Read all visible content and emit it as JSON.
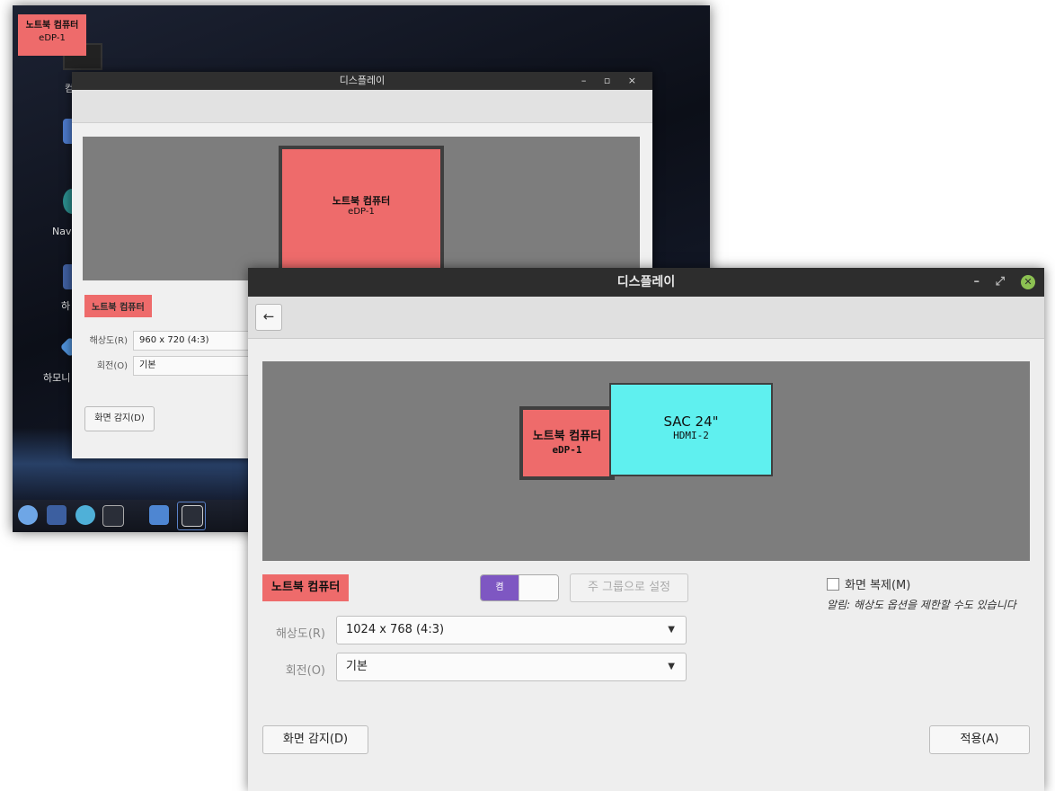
{
  "background_window": {
    "osd_label": {
      "name": "노트북 컴퓨터",
      "connector": "eDP-1"
    },
    "title": "디스플레이",
    "controls": "– ▫ ×",
    "monitor": {
      "name": "노트북 컴퓨터",
      "connector": "eDP-1"
    },
    "monitor_tag": "노트북 컴퓨터",
    "resolution_label": "해상도(R)",
    "resolution_value": "960 x 720 (4:3)",
    "rotation_label": "회전(O)",
    "rotation_value": "기본",
    "detect_button": "화면 감지(D)",
    "desktop_icons": [
      "컴",
      "Nave",
      "하",
      "하모니"
    ]
  },
  "window": {
    "title": "디스플레이",
    "minimize": "–",
    "maximize": "⤢",
    "close": "✕"
  },
  "toolbar": {
    "back_icon": "←"
  },
  "monitors": [
    {
      "name": "노트북 컴퓨터",
      "connector": "eDP-1",
      "color": "#ee6b6b"
    },
    {
      "name": "SAC 24\"",
      "connector": "HDMI-2",
      "color": "#5ff0ef"
    }
  ],
  "settings": {
    "selected_monitor": "노트북 컴퓨터",
    "toggle_on_label": "켬",
    "set_primary_button": "주 그룹으로 설정",
    "mirror_label": "화면 복제(M)",
    "mirror_checked": false,
    "note": "알림: 해상도 옵션을 제한할 수도 있습니다",
    "resolution_label": "해상도(R)",
    "resolution_value": "1024 x 768 (4:3)",
    "rotation_label": "회전(O)",
    "rotation_value": "기본"
  },
  "actions": {
    "detect_button": "화면 감지(D)",
    "apply_button": "적용(A)"
  },
  "colors": {
    "accent_toggle": "#7e57c2",
    "laptop_monitor": "#ee6b6b",
    "external_monitor": "#5ff0ef"
  }
}
